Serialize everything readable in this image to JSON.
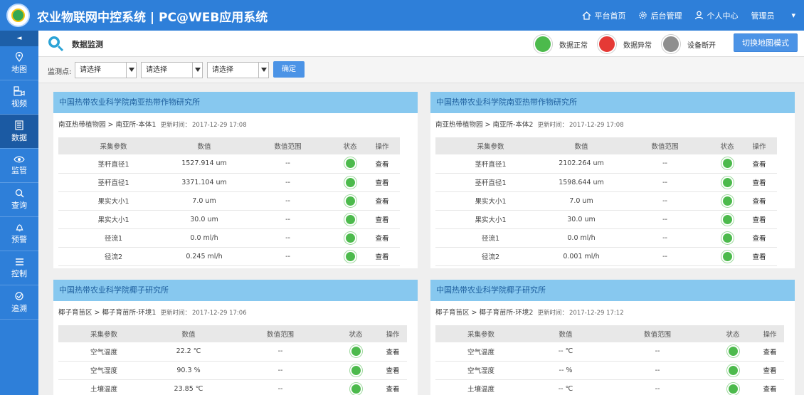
{
  "header": {
    "title": "农业物联网中控系统 | PC@WEB应用系统",
    "nav": [
      {
        "label": "平台首页",
        "icon": "home-icon"
      },
      {
        "label": "后台管理",
        "icon": "gear-icon"
      },
      {
        "label": "个人中心",
        "icon": "user-icon"
      },
      {
        "label": "管理员",
        "icon": ""
      }
    ]
  },
  "sidebar": {
    "collapse": "◄",
    "items": [
      {
        "label": "地图",
        "icon": "map-pin-icon"
      },
      {
        "label": "视频",
        "icon": "camera-icon"
      },
      {
        "label": "数据",
        "icon": "data-icon"
      },
      {
        "label": "监管",
        "icon": "eye-icon"
      },
      {
        "label": "查询",
        "icon": "search-icon"
      },
      {
        "label": "预警",
        "icon": "bell-icon"
      },
      {
        "label": "控制",
        "icon": "control-icon"
      },
      {
        "label": "追溯",
        "icon": "trace-icon"
      }
    ]
  },
  "page": {
    "title": "数据监测",
    "legend": {
      "normal": "数据正常",
      "abnormal": "数据异常",
      "disconnected": "设备断开"
    },
    "map_button": "切换地图模式"
  },
  "filter": {
    "label": "监测点:",
    "selects": [
      "请选择",
      "请选择",
      "请选择"
    ],
    "confirm": "确定"
  },
  "colors": {
    "primary": "#2e7fd9",
    "panel_header": "#87c8ef",
    "normal": "#4cba4c",
    "abnormal": "#e53935",
    "disconnected": "#8e8e8e"
  },
  "table_headers": [
    "采集参数",
    "数值",
    "数值范围",
    "状态",
    "操作"
  ],
  "panels": [
    {
      "title": "中国热带农业科学院南亚热带作物研究所",
      "path": "南亚热带植物园 > 南亚所-本体1",
      "update_label": "更新时间：",
      "update_time": "2017-12-29 17:08",
      "rows": [
        {
          "param": "茎秆直径1",
          "value": "1527.914 um",
          "range": "--",
          "action": "查看"
        },
        {
          "param": "茎秆直径1",
          "value": "3371.104 um",
          "range": "--",
          "action": "查看"
        },
        {
          "param": "果实大小1",
          "value": "7.0 um",
          "range": "--",
          "action": "查看"
        },
        {
          "param": "果实大小1",
          "value": "30.0 um",
          "range": "--",
          "action": "查看"
        },
        {
          "param": "径流1",
          "value": "0.0 ml/h",
          "range": "--",
          "action": "查看"
        },
        {
          "param": "径流2",
          "value": "0.245 ml/h",
          "range": "--",
          "action": "查看"
        }
      ]
    },
    {
      "title": "中国热带农业科学院南亚热带作物研究所",
      "path": "南亚热带植物园 > 南亚所-本体2",
      "update_label": "更新时间：",
      "update_time": "2017-12-29 17:08",
      "rows": [
        {
          "param": "茎秆直径1",
          "value": "2102.264 um",
          "range": "--",
          "action": "查看"
        },
        {
          "param": "茎秆直径1",
          "value": "1598.644 um",
          "range": "--",
          "action": "查看"
        },
        {
          "param": "果实大小1",
          "value": "7.0 um",
          "range": "--",
          "action": "查看"
        },
        {
          "param": "果实大小1",
          "value": "30.0 um",
          "range": "--",
          "action": "查看"
        },
        {
          "param": "径流1",
          "value": "0.0 ml/h",
          "range": "--",
          "action": "查看"
        },
        {
          "param": "径流2",
          "value": "0.001 ml/h",
          "range": "--",
          "action": "查看"
        }
      ]
    },
    {
      "title": "中国热带农业科学院椰子研究所",
      "path": "椰子育苗区 > 椰子育苗所-环境1",
      "update_label": "更新时间：",
      "update_time": "2017-12-29 17:06",
      "rows": [
        {
          "param": "空气温度",
          "value": "22.2 ℃",
          "range": "--",
          "action": "查看"
        },
        {
          "param": "空气湿度",
          "value": "90.3 %",
          "range": "--",
          "action": "查看"
        },
        {
          "param": "土壤温度",
          "value": "23.85 ℃",
          "range": "--",
          "action": "查看"
        }
      ]
    },
    {
      "title": "中国热带农业科学院椰子研究所",
      "path": "椰子育苗区 > 椰子育苗所-环境2",
      "update_label": "更新时间：",
      "update_time": "2017-12-29 17:12",
      "rows": [
        {
          "param": "空气温度",
          "value": "-- ℃",
          "range": "--",
          "action": "查看"
        },
        {
          "param": "空气湿度",
          "value": "-- %",
          "range": "--",
          "action": "查看"
        },
        {
          "param": "土壤温度",
          "value": "-- ℃",
          "range": "--",
          "action": "查看"
        }
      ]
    }
  ]
}
